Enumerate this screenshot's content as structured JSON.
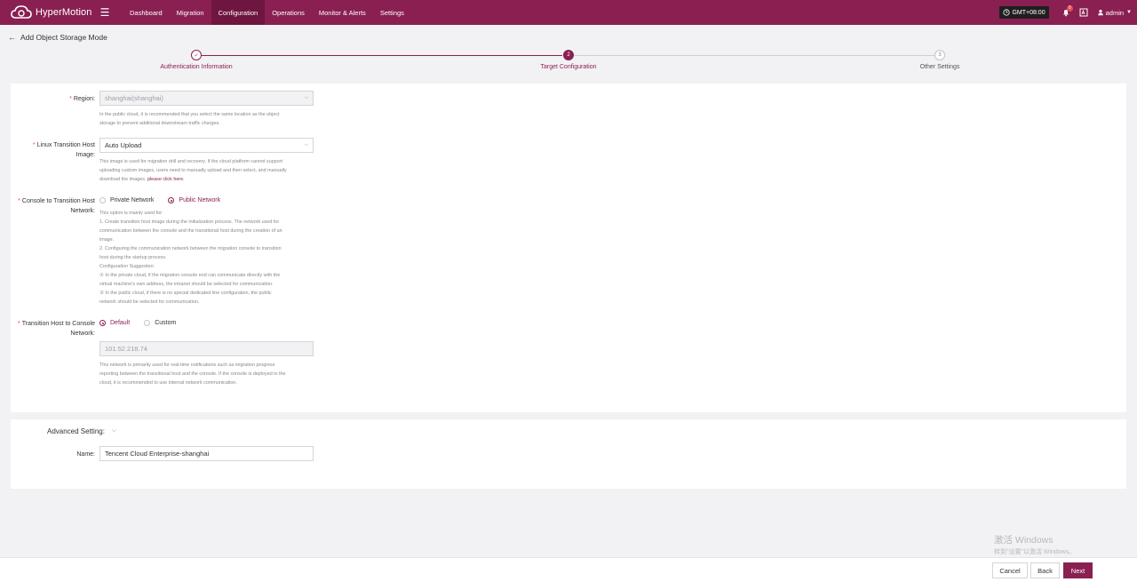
{
  "app": {
    "name": "HyperMotion"
  },
  "nav": {
    "items": [
      {
        "label": "Dashboard"
      },
      {
        "label": "Migration"
      },
      {
        "label": "Configuration"
      },
      {
        "label": "Operations"
      },
      {
        "label": "Monitor & Alerts"
      },
      {
        "label": "Settings"
      }
    ],
    "active": "Configuration"
  },
  "topbar": {
    "timezone": "GMT+08:00",
    "notification_count": "0",
    "user": "admin"
  },
  "page": {
    "title": "Add Object Storage Mode"
  },
  "stepper": {
    "steps": [
      {
        "number": "✓",
        "label": "Authentication Information",
        "state": "done"
      },
      {
        "number": "2",
        "label": "Target Configuration",
        "state": "active"
      },
      {
        "number": "3",
        "label": "Other Settings",
        "state": "todo"
      }
    ]
  },
  "form": {
    "region": {
      "label": "Region:",
      "value": "shanghai(shanghai)",
      "help": [
        "In the public cloud, it is recommended that you select the same location as the object",
        "storage to prevent additional downstream traffic charges."
      ]
    },
    "linux_image": {
      "label_line1": "Linux Transition Host",
      "label_line2": "Image:",
      "value": "Auto Upload",
      "help": [
        "This image is used for migration drill and recovery. If the cloud platform cannot support",
        "uploading custom images, users need to manually upload and then select, and manually",
        "download the images."
      ],
      "help_link": "please click here."
    },
    "console_network": {
      "label_line1": "Console to Transition Host",
      "label_line2": "Network:",
      "options": [
        "Private Network",
        "Public Network"
      ],
      "selected": "Public Network",
      "help": [
        "This option is mainly used for:",
        "1. Create transition host image during the initialization process. The network used for",
        "communication between the console and the transitional host during the creation of an",
        "image.",
        "2. Configuring the communication network between the migration console to transition",
        "host during the startup process.",
        "Configuration Suggestion:",
        "① In the private cloud, if the migration console end can communicate directly with the",
        "virtual machine's own address, the intranet should be selected for communication.",
        "② In the public cloud, if there is no special dedicated line configuration, the public",
        "network should be selected for communication."
      ]
    },
    "host_network": {
      "label_line1": "Transition Host to Console",
      "label_line2": "Network:",
      "options": [
        "Default",
        "Custom"
      ],
      "selected": "Default",
      "ip_value": "101.52.218.74",
      "help": [
        "This network is primarily used for real-time notifications such as migration progress",
        "reporting between the transitional host and the console. If the console is deployed in the",
        "cloud, it is recommended to use internal network communication."
      ]
    }
  },
  "advanced": {
    "title": "Advanced Setting:",
    "name_label": "Name:",
    "name_value": "Tencent Cloud Enterprise-shanghai"
  },
  "footer": {
    "cancel": "Cancel",
    "back": "Back",
    "next": "Next"
  },
  "watermark": {
    "line1": "激活 Windows",
    "line2": "转到\"设置\"以激活 Windows。"
  },
  "colors": {
    "brand": "#8a1f52",
    "required": "#e34b4b"
  }
}
